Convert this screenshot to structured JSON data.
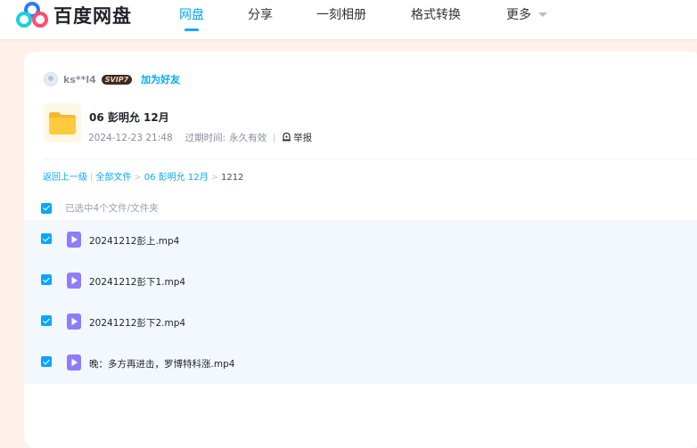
{
  "brand": {
    "name": "百度网盘",
    "colors": {
      "accent": "#06a7ff",
      "logo_blue": "#2c7bf6",
      "logo_cyan": "#18d2d9",
      "logo_red": "#ff4d6b"
    }
  },
  "nav": {
    "items": [
      {
        "label": "网盘",
        "active": true
      },
      {
        "label": "分享",
        "active": false
      },
      {
        "label": "一刻相册",
        "active": false
      },
      {
        "label": "格式转换",
        "active": false
      },
      {
        "label": "更多",
        "active": false
      }
    ]
  },
  "share": {
    "username": "ks**l4",
    "vip_badge": "SVIP7",
    "add_friend": "加为好友",
    "folder_name": "06 彭明允 12月",
    "created_at": "2024-12-23 21:48",
    "expire_label": "过期时间:",
    "expire_value": "永久有效",
    "report": "举报"
  },
  "breadcrumb": {
    "back": "返回上一级",
    "all_files": "全部文件",
    "folder": "06 彭明允 12月",
    "current": "1212"
  },
  "selection": {
    "summary": "已选中4个文件/文件夹"
  },
  "files": [
    {
      "name": "20241212彭上.mp4",
      "checked": true,
      "icon": "video-file-icon"
    },
    {
      "name": "20241212彭下1.mp4",
      "checked": true,
      "icon": "video-file-icon"
    },
    {
      "name": "20241212彭下2.mp4",
      "checked": true,
      "icon": "video-file-icon"
    },
    {
      "name": "晚：多方再进击，罗博特科涨.mp4",
      "checked": true,
      "icon": "video-file-icon"
    }
  ]
}
